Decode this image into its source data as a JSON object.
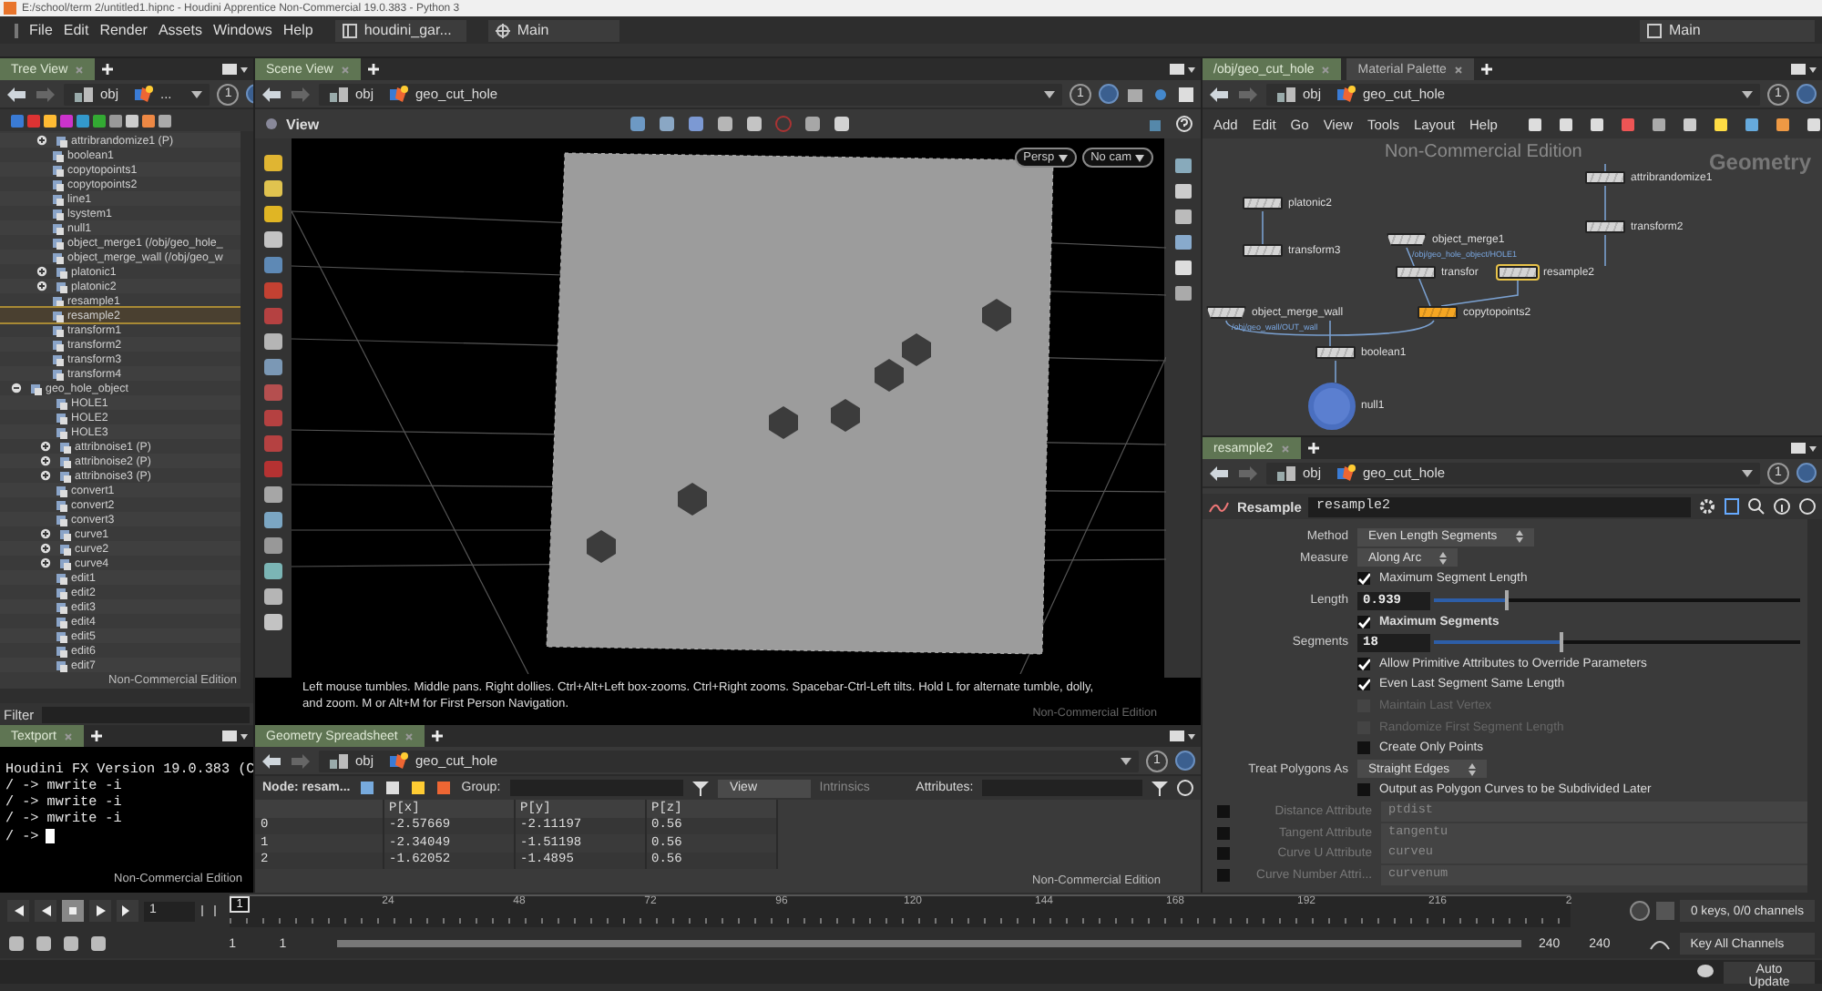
{
  "window": {
    "title": "E:/school/term 2/untitled1.hipnc - Houdini Apprentice Non-Commercial 19.0.383 - Python 3"
  },
  "menu": {
    "items": [
      "File",
      "Edit",
      "Render",
      "Assets",
      "Windows",
      "Help"
    ],
    "desktop": "houdini_gar...",
    "context": "Main",
    "right_desktop": "Main"
  },
  "tree_view": {
    "tabs": [
      {
        "label": "Tree View",
        "selected": true
      }
    ],
    "path": [
      "obj",
      "..."
    ],
    "pin": "1",
    "scrolled_children": [
      {
        "label": "attribrandomize1 (P)",
        "selected": false,
        "expanded": false
      },
      {
        "label": "boolean1",
        "selected": false
      },
      {
        "label": "copytopoints1",
        "selected": false
      },
      {
        "label": "copytopoints2",
        "selected": false
      },
      {
        "label": "line1",
        "selected": false
      },
      {
        "label": "lsystem1",
        "selected": false
      },
      {
        "label": "null1",
        "selected": false
      },
      {
        "label": "object_merge1 (/obj/geo_hole_",
        "selected": false
      },
      {
        "label": "object_merge_wall (/obj/geo_w",
        "selected": false
      },
      {
        "label": "platonic1",
        "selected": false,
        "expanded": false
      },
      {
        "label": "platonic2",
        "selected": false,
        "expanded": false
      },
      {
        "label": "resample1",
        "selected": false
      },
      {
        "label": "resample2",
        "selected": true
      },
      {
        "label": "transform1",
        "selected": false
      },
      {
        "label": "transform2",
        "selected": false
      },
      {
        "label": "transform3",
        "selected": false
      },
      {
        "label": "transform4",
        "selected": false
      }
    ],
    "items": [
      {
        "label": "geo_hole_object",
        "selected": false,
        "expanded": true,
        "children": [
          {
            "label": "HOLE1",
            "selected": false
          },
          {
            "label": "HOLE2",
            "selected": false
          },
          {
            "label": "HOLE3",
            "selected": false
          },
          {
            "label": "attribnoise1 (P)",
            "selected": false,
            "expanded": false
          },
          {
            "label": "attribnoise2 (P)",
            "selected": false,
            "expanded": false
          },
          {
            "label": "attribnoise3 (P)",
            "selected": false,
            "expanded": false
          },
          {
            "label": "convert1",
            "selected": false
          },
          {
            "label": "convert2",
            "selected": false
          },
          {
            "label": "convert3",
            "selected": false
          },
          {
            "label": "curve1",
            "selected": false,
            "expanded": false
          },
          {
            "label": "curve2",
            "selected": false,
            "expanded": false
          },
          {
            "label": "curve4",
            "selected": false,
            "expanded": false
          },
          {
            "label": "edit1",
            "selected": false
          },
          {
            "label": "edit2",
            "selected": false
          },
          {
            "label": "edit3",
            "selected": false
          },
          {
            "label": "edit4",
            "selected": false
          },
          {
            "label": "edit5",
            "selected": false
          },
          {
            "label": "edit6",
            "selected": false
          },
          {
            "label": "edit7",
            "selected": false
          }
        ]
      }
    ],
    "watermark": "Non-Commercial Edition",
    "filter_label": "Filter"
  },
  "textport": {
    "tabs": [
      {
        "label": "Textport",
        "selected": true
      }
    ],
    "lines": [
      "Houdini FX Version 19.0.383 (C",
      "/ -> mwrite -i",
      "/ -> mwrite -i",
      "/ -> mwrite -i"
    ],
    "prompt": "/ ->",
    "watermark": "Non-Commercial Edition"
  },
  "scene_view": {
    "tabs": [
      {
        "label": "Scene View",
        "selected": true
      }
    ],
    "path": [
      "obj",
      "geo_cut_hole"
    ],
    "pin": "1",
    "view_label": "View",
    "camera_buttons": [
      "Persp",
      "No cam"
    ],
    "hint": "Left mouse tumbles. Middle pans. Right dollies. Ctrl+Alt+Left box-zooms. Ctrl+Right zooms. Spacebar-Ctrl-Left tilts. Hold L for alternate tumble, dolly, and zoom.     M or Alt+M for First Person Navigation.",
    "watermark": "Non-Commercial Edition"
  },
  "spreadsheet": {
    "tabs": [
      {
        "label": "Geometry Spreadsheet",
        "selected": true
      }
    ],
    "path": [
      "obj",
      "geo_cut_hole"
    ],
    "pin": "1",
    "node_label": "Node: resam...",
    "group_label": "Group:",
    "view": "View",
    "intrinsics": "Intrinsics",
    "attributes_label": "Attributes:",
    "columns": [
      "P[x]",
      "P[y]",
      "P[z]"
    ],
    "rows": [
      {
        "index": "0",
        "cells": [
          "-2.57669",
          "-2.11197",
          "0.56"
        ]
      },
      {
        "index": "1",
        "cells": [
          "-2.34049",
          "-1.51198",
          "0.56"
        ]
      },
      {
        "index": "2",
        "cells": [
          "-1.62052",
          "-1.4895",
          "0.56"
        ]
      }
    ],
    "watermark": "Non-Commercial Edition"
  },
  "network": {
    "tabs": [
      {
        "label": "/obj/geo_cut_hole",
        "selected": true
      },
      {
        "label": "Material Palette",
        "selected": false
      }
    ],
    "path": [
      "obj",
      "geo_cut_hole"
    ],
    "pin": "1",
    "menu": [
      "Add",
      "Edit",
      "Go",
      "View",
      "Tools",
      "Layout",
      "Help"
    ],
    "watermark": "Non-Commercial Edition",
    "context_label": "Geometry",
    "nodes": [
      {
        "label": "attribrandomize1",
        "kind": "sop",
        "selected": false,
        "color": "#d4d4d4"
      },
      {
        "label": "platonic2",
        "kind": "sop",
        "selected": false,
        "color": "#d4d4d4"
      },
      {
        "label": "transform2",
        "kind": "sop",
        "selected": false,
        "color": "#d4d4d4"
      },
      {
        "label": "transform3",
        "kind": "sop",
        "selected": false,
        "color": "#d4d4d4"
      },
      {
        "label": "object_merge1",
        "sublabel": "/obj/geo_hole_object/HOLE1",
        "kind": "merge",
        "selected": false,
        "color": "#d4d4d4"
      },
      {
        "label": "transfor",
        "kind": "sop",
        "selected": false,
        "color": "#d4d4d4"
      },
      {
        "label": "resample2",
        "kind": "sop",
        "selected": true,
        "color": "#d4d4d4"
      },
      {
        "label": "object_merge_wall",
        "sublabel": "/obj/geo_wall/OUT_wall",
        "kind": "merge",
        "selected": false,
        "color": "#d4d4d4"
      },
      {
        "label": "copytopoints2",
        "kind": "sop",
        "selected": false,
        "color": "#f5a623"
      },
      {
        "label": "boolean1",
        "kind": "sop",
        "selected": false,
        "color": "#d4d4d4"
      },
      {
        "label": "null1",
        "kind": "null",
        "selected": false,
        "color": "#5b7fd0"
      }
    ]
  },
  "parameters": {
    "tabs": [
      {
        "label": "resample2",
        "selected": true
      }
    ],
    "path": [
      "obj",
      "geo_cut_hole"
    ],
    "pin": "1",
    "node_type": "Resample",
    "node_name": "resample2",
    "rows": [
      {
        "kind": "menu",
        "label": "Method",
        "value": "Even Length Segments"
      },
      {
        "kind": "menu",
        "label": "Measure",
        "value": "Along Arc"
      },
      {
        "kind": "check",
        "label": "Maximum Segment Length",
        "checked": true,
        "disabled": false
      },
      {
        "kind": "slider",
        "label": "Length",
        "value": "0.939",
        "level": 0.2
      },
      {
        "kind": "check",
        "label": "Maximum Segments",
        "checked": true,
        "disabled": false
      },
      {
        "kind": "slider",
        "label": "Segments",
        "value": "18",
        "level": 0.35
      },
      {
        "kind": "check",
        "label": "Allow Primitive Attributes to Override Parameters",
        "checked": true,
        "disabled": false
      },
      {
        "kind": "check",
        "label": "Even Last Segment Same Length",
        "checked": true,
        "disabled": false
      },
      {
        "kind": "check",
        "label": "Maintain Last Vertex",
        "checked": false,
        "disabled": true
      },
      {
        "kind": "check",
        "label": "Randomize First Segment Length",
        "checked": false,
        "disabled": true
      },
      {
        "kind": "check",
        "label": "Create Only Points",
        "checked": false,
        "disabled": false
      },
      {
        "kind": "menu",
        "label": "Treat Polygons As",
        "value": "Straight Edges"
      },
      {
        "kind": "check",
        "label": "Output as Polygon Curves to be Subdivided Later",
        "checked": false,
        "disabled": false
      },
      {
        "kind": "attr",
        "label": "Distance Attribute",
        "value": "ptdist",
        "checked": false
      },
      {
        "kind": "attr",
        "label": "Tangent Attribute",
        "value": "tangentu",
        "checked": false
      },
      {
        "kind": "attr",
        "label": "Curve U Attribute",
        "value": "curveu",
        "checked": false
      },
      {
        "kind": "attr",
        "label": "Curve Number Attri...",
        "value": "curvenum",
        "checked": false
      }
    ]
  },
  "timeline": {
    "current_frame": "1",
    "ruler_frame": "1",
    "range_bar": {
      "level": 1
    },
    "ticks": [
      "24",
      "48",
      "72",
      "96",
      "120",
      "144",
      "168",
      "192",
      "216",
      "2"
    ],
    "range_start": "1",
    "playback_start": "1",
    "playback_end": "240",
    "range_end": "240",
    "keys_label": "0 keys, 0/0 channels",
    "key_button": "Key All Channels",
    "update_button": "Auto Update"
  }
}
